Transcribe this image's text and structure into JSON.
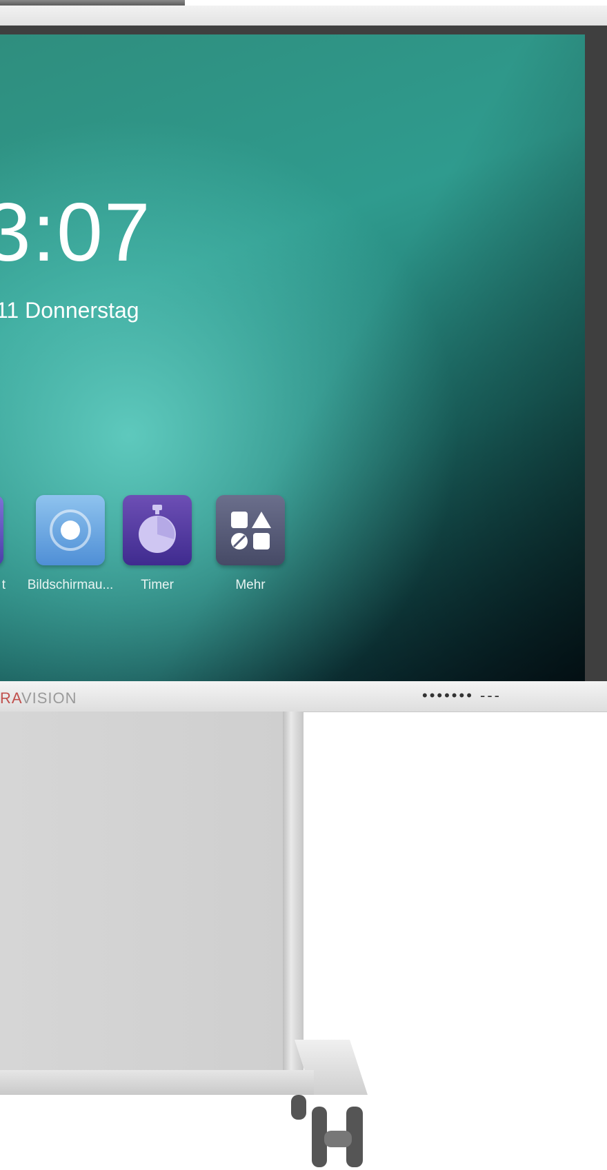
{
  "home_screen": {
    "clock": "3:07",
    "date": "11 Donnerstag",
    "apps": [
      {
        "label": "t",
        "icon": "partial-app-icon"
      },
      {
        "label": "Bildschirmau...",
        "icon": "screensaver-icon"
      },
      {
        "label": "Timer",
        "icon": "stopwatch-icon"
      },
      {
        "label": "Mehr",
        "icon": "more-apps-icon"
      }
    ]
  },
  "bezel": {
    "brand_accent": "RA",
    "brand_rest": "VISION",
    "indicators": "•••••••  ---"
  },
  "colors": {
    "screen_accent": "#2f9b8e",
    "timer_tile": "#4a3399",
    "more_tile": "#5a5e7c",
    "screensaver_tile": "#6aa6e2",
    "brand_red": "#c0504d"
  }
}
